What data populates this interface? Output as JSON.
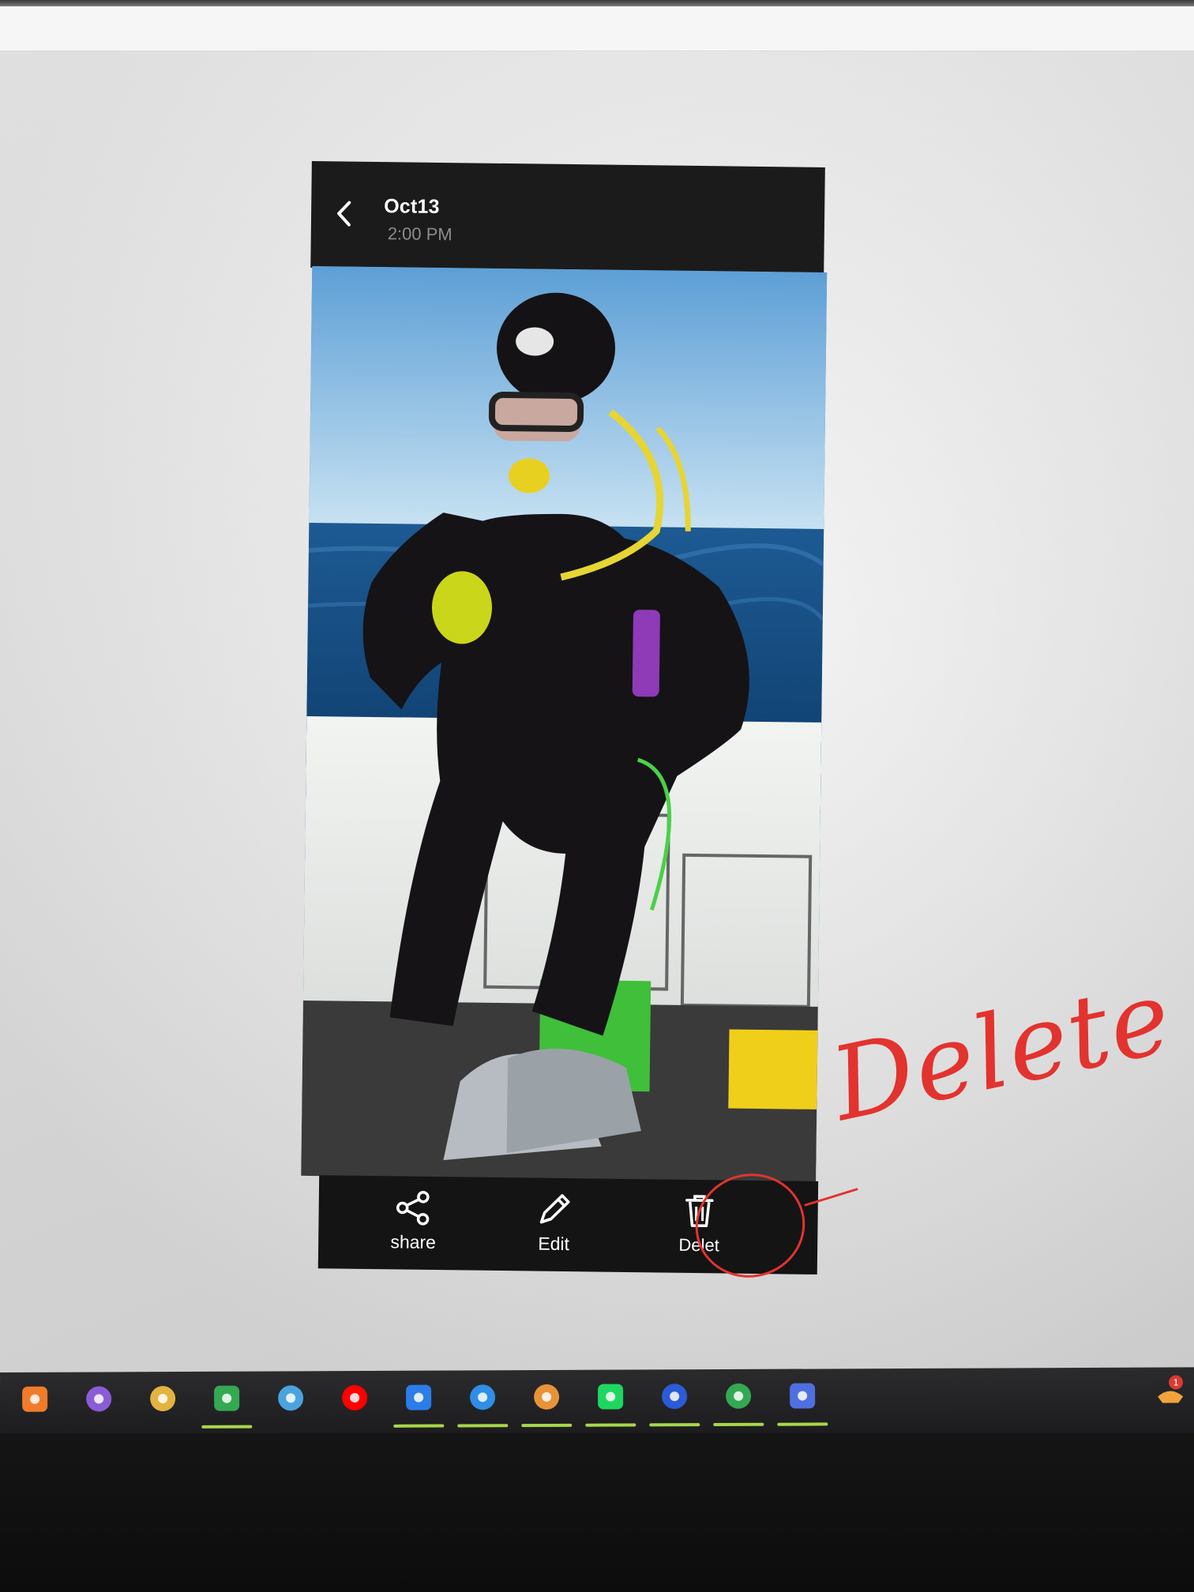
{
  "viewer": {
    "date": "Oct13",
    "time": "2:00 PM",
    "back_icon": "chevron-left-icon"
  },
  "toolbar": {
    "share_label": "share",
    "edit_label": "Edit",
    "delete_label": "Delet"
  },
  "annotation": {
    "text": "Delete",
    "color": "#e2332f"
  },
  "taskbar": {
    "apps": [
      {
        "icon": "xampp-icon",
        "color": "#f07c2b",
        "active": false
      },
      {
        "icon": "visual-studio-icon",
        "color": "#8a5cd6",
        "active": false
      },
      {
        "icon": "snipping-tool-icon",
        "color": "#e3b341",
        "active": false
      },
      {
        "icon": "chrome-icon",
        "color": "#34a853",
        "active": true
      },
      {
        "icon": "paint-icon",
        "color": "#4aa3df",
        "active": false
      },
      {
        "icon": "youtube-icon",
        "color": "#ff0000",
        "active": false
      },
      {
        "icon": "bing-copilot-icon",
        "color": "#2b7de9",
        "active": true
      },
      {
        "icon": "vscode-icon",
        "color": "#2f8ee6",
        "active": true
      },
      {
        "icon": "sublime-box-icon",
        "color": "#e8923a",
        "active": true
      },
      {
        "icon": "spotify-icon",
        "color": "#1ed760",
        "active": true
      },
      {
        "icon": "word-icon",
        "color": "#2b5bd7",
        "active": true
      },
      {
        "icon": "chrome-profile-icon",
        "color": "#34a853",
        "active": true
      },
      {
        "icon": "xcode-tool-icon",
        "color": "#4f6fe0",
        "active": true
      }
    ],
    "tray_badge": "1"
  }
}
